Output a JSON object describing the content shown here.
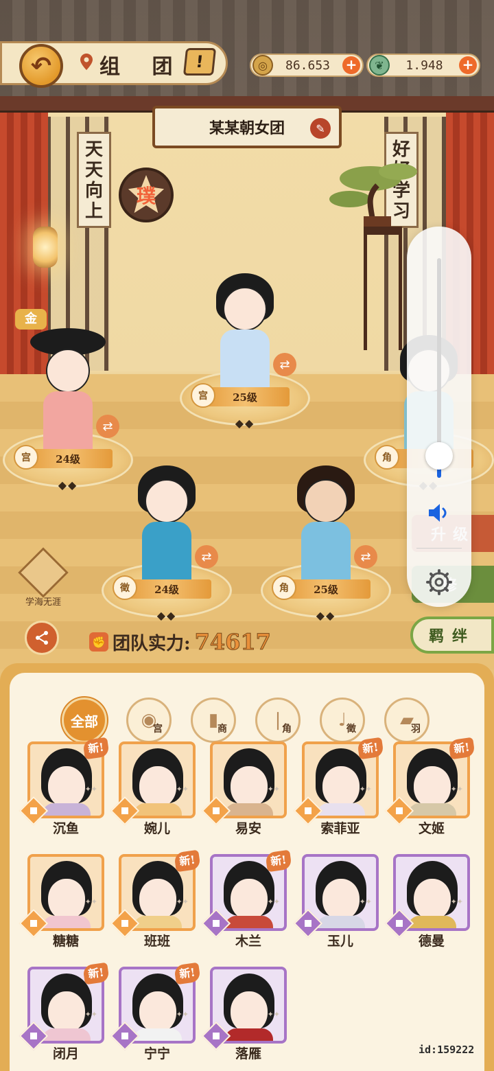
{
  "header": {
    "title": "组 团",
    "alert_glyph": "!",
    "back_icon": "back-arrow-icon",
    "location_icon": "location-pin-icon"
  },
  "resources": {
    "coins": {
      "value": "86.653",
      "icon": "coin-icon",
      "plus": "+"
    },
    "jade": {
      "value": "1.948",
      "icon": "jade-icon",
      "plus": "+"
    }
  },
  "team": {
    "name": "某某朝女团",
    "edit_icon": "brush-edit-icon",
    "seal_char": "璞",
    "scroll_left": [
      "天",
      "天",
      "向",
      "上"
    ],
    "scroll_right": [
      "好",
      "好",
      "学",
      "习"
    ]
  },
  "stage": {
    "slots": [
      {
        "level": "25级",
        "stars": "◆◆",
        "class_glyph": "宫",
        "robe_color": "#c8dff4"
      },
      {
        "level": "24级",
        "stars": "◆◆",
        "class_glyph": "宫",
        "robe_color": "#f2a6a0"
      },
      {
        "level": "24级",
        "stars": "◆◆",
        "class_glyph": "徵",
        "robe_color": "#3aa0c8"
      },
      {
        "level": "25级",
        "stars": "◆◆",
        "class_glyph": "角",
        "robe_color": "#7cc0e0"
      },
      {
        "level": "2",
        "stars": "◆◆",
        "class_glyph": "角",
        "robe_color": "#88c8d8"
      }
    ],
    "gold_badge": "金",
    "swap_glyph": "⇄"
  },
  "side": {
    "study_label": "学海无涯",
    "share_glyph": "⋲",
    "upgrade_label": "升级",
    "cultivate_label": "修",
    "bond_label": "羁绊"
  },
  "power": {
    "label": "团队实力:",
    "value": "74617"
  },
  "volume": {
    "level": 0.1
  },
  "filters": [
    {
      "id": "all",
      "text": "全部",
      "glyph": "",
      "sub": ""
    },
    {
      "id": "gong",
      "text": "",
      "glyph": "◉",
      "sub": "宫"
    },
    {
      "id": "shang",
      "text": "",
      "glyph": "▮",
      "sub": "商"
    },
    {
      "id": "jue",
      "text": "",
      "glyph": "❘",
      "sub": "角"
    },
    {
      "id": "zhi",
      "text": "",
      "glyph": "♩",
      "sub": "徵"
    },
    {
      "id": "yu",
      "text": "",
      "glyph": "▰",
      "sub": "羽"
    }
  ],
  "roster": [
    {
      "name": "沉鱼",
      "rarity": "orange",
      "new": true,
      "robe": "#c8b3d8"
    },
    {
      "name": "婉儿",
      "rarity": "orange",
      "new": false,
      "robe": "#f1c37a"
    },
    {
      "name": "易安",
      "rarity": "orange",
      "new": false,
      "robe": "#d9b48f"
    },
    {
      "name": "索菲亚",
      "rarity": "orange",
      "new": true,
      "robe": "#e8e0ee"
    },
    {
      "name": "文姬",
      "rarity": "orange",
      "new": true,
      "robe": "#d6c8a8"
    },
    {
      "name": "糖糖",
      "rarity": "orange",
      "new": false,
      "robe": "#f1c6cf"
    },
    {
      "name": "班班",
      "rarity": "orange",
      "new": true,
      "robe": "#f0cf8a"
    },
    {
      "name": "木兰",
      "rarity": "purple",
      "new": true,
      "robe": "#c84a3a"
    },
    {
      "name": "玉儿",
      "rarity": "purple",
      "new": false,
      "robe": "#d7d7e6"
    },
    {
      "name": "德曼",
      "rarity": "purple",
      "new": false,
      "robe": "#e0b85a"
    },
    {
      "name": "闭月",
      "rarity": "purple",
      "new": true,
      "robe": "#efc6d2"
    },
    {
      "name": "宁宁",
      "rarity": "purple",
      "new": true,
      "robe": "#f2f2f2"
    },
    {
      "name": "落雁",
      "rarity": "purple",
      "new": false,
      "robe": "#b22a2a"
    }
  ],
  "new_badge": "新!",
  "mini_stars": "✦✦",
  "user_id": "id:159222"
}
